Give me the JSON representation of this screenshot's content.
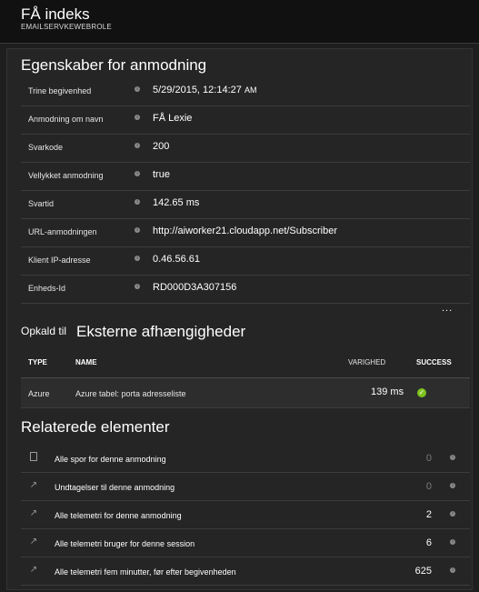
{
  "header": {
    "title": "FÅ indeks",
    "subtitle": "EMAILSERVKEWEBROLE"
  },
  "properties": {
    "title": "Egenskaber for anmodning",
    "rows": [
      {
        "label": "Trine begivenhed",
        "value": "5/29/2015, 12:14:27",
        "suffix": "AM"
      },
      {
        "label": "Anmodning om navn",
        "value": "FÅ Lexie",
        "suffix": ""
      },
      {
        "label": "Svarkode",
        "value": "200",
        "suffix": ""
      },
      {
        "label": "Vellykket anmodning",
        "value": "true",
        "suffix": ""
      },
      {
        "label": "Svartid",
        "value": "142.65 ms",
        "suffix": ""
      },
      {
        "label": "URL-anmodningen",
        "value": "http://aiworker21.cloudapp.net/Subscriber",
        "suffix": ""
      },
      {
        "label": "Klient IP-adresse",
        "value": "0.46.56.61",
        "suffix": ""
      },
      {
        "label": "Enheds-Id",
        "value": "RD000D3A307156",
        "suffix": ""
      }
    ],
    "more": "..."
  },
  "dependencies": {
    "prefix": "Opkald til",
    "title": "Eksterne afhængigheder",
    "columns": {
      "type": "TYPE",
      "name": "NAME",
      "duration": "VARIGHED",
      "success": "SUCCESS"
    },
    "rows": [
      {
        "type": "Azure",
        "name": "Azure tabel: porta adresseliste",
        "duration": "139 ms",
        "success": "✓"
      }
    ]
  },
  "related": {
    "title": "Relaterede elementer",
    "items": [
      {
        "icon": "document-icon",
        "label": "Alle spor for denne anmodning",
        "count": "0"
      },
      {
        "icon": "arrow-icon",
        "label": "Undtagelser til denne anmodning",
        "count": "0"
      },
      {
        "icon": "arrow-icon",
        "label": "Alle telemetri for denne anmodning",
        "count": "2"
      },
      {
        "icon": "arrow-icon",
        "label": "Alle telemetri bruger for denne session",
        "count": "6"
      },
      {
        "icon": "arrow-icon",
        "label": "Alle telemetri fem minutter, før efter begivenheden",
        "count": "625"
      }
    ]
  },
  "colors": {
    "background": "#1e1e1e",
    "panel": "#252526",
    "success": "#7ec21c"
  }
}
